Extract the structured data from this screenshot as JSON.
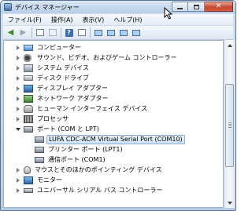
{
  "window": {
    "title": "デバイス マネージャー"
  },
  "menu": [
    "ファイル(F)",
    "操作(A)",
    "表示(V)",
    "ヘルプ(H)"
  ],
  "toolbar": {
    "buttons": [
      "back-icon",
      "forward-icon",
      "show-hide-tree-icon",
      "properties-icon",
      "help-icon",
      "console-icon",
      "scan-hardware-icon",
      "update-driver-icon",
      "uninstall-icon",
      "disable-icon"
    ]
  },
  "tree": {
    "items": [
      {
        "label": "コンピューター",
        "icon": "computer-icon",
        "level": 1,
        "state": "collapsed"
      },
      {
        "label": "サウンド、ビデオ、およびゲーム コントローラー",
        "icon": "sound-icon",
        "level": 1,
        "state": "collapsed"
      },
      {
        "label": "システム デバイス",
        "icon": "system-device-icon",
        "level": 1,
        "state": "collapsed"
      },
      {
        "label": "ディスク ドライブ",
        "icon": "disk-drive-icon",
        "level": 1,
        "state": "collapsed"
      },
      {
        "label": "ディスプレイ アダプター",
        "icon": "display-adapter-icon",
        "level": 1,
        "state": "collapsed"
      },
      {
        "label": "ネットワーク アダプター",
        "icon": "network-adapter-icon",
        "level": 1,
        "state": "collapsed"
      },
      {
        "label": "ヒューマン インターフェイス デバイス",
        "icon": "hid-icon",
        "level": 1,
        "state": "collapsed"
      },
      {
        "label": "プロセッサ",
        "icon": "processor-icon",
        "level": 1,
        "state": "collapsed"
      },
      {
        "label": "ポート (COM と LPT)",
        "icon": "port-icon",
        "level": 1,
        "state": "expanded"
      },
      {
        "label": "LUFA CDC-ACM Virtual Serial Port (COM10)",
        "icon": "port-icon",
        "level": 2,
        "state": "leaf",
        "selected": true
      },
      {
        "label": "プリンター ポート (LPT1)",
        "icon": "port-icon",
        "level": 2,
        "state": "leaf"
      },
      {
        "label": "通信ポート (COM1)",
        "icon": "port-icon",
        "level": 2,
        "state": "leaf"
      },
      {
        "label": "マウスとそのほかのポインティング デバイス",
        "icon": "mouse-icon",
        "level": 1,
        "state": "collapsed"
      },
      {
        "label": "モニター",
        "icon": "monitor-icon",
        "level": 1,
        "state": "collapsed"
      },
      {
        "label": "ユニバーサル シリアル バス コントローラー",
        "icon": "usb-controller-icon",
        "level": 1,
        "state": "collapsed"
      }
    ]
  },
  "colors": {
    "selection_border": "#84acdd",
    "close_button": "#c7462e",
    "frame": "#b7cde4"
  }
}
